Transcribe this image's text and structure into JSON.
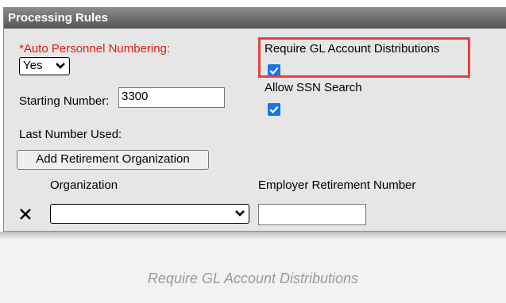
{
  "panel": {
    "title": "Processing Rules"
  },
  "auto_numbering": {
    "label": "*Auto Personnel Numbering:",
    "value": "Yes"
  },
  "starting_number": {
    "label": "Starting Number:",
    "value": "3300"
  },
  "last_number": {
    "label": "Last Number Used:"
  },
  "require_gl": {
    "label": "Require GL Account Distributions",
    "checked": true
  },
  "allow_ssn": {
    "label": "Allow SSN Search",
    "checked": true
  },
  "retirement": {
    "add_button_label": "Add Retirement Organization",
    "col_organization": "Organization",
    "col_employer_number": "Employer Retirement Number",
    "organization_value": "",
    "employer_number_value": ""
  },
  "caption": "Require GL Account Distributions",
  "colors": {
    "required_label": "#e8170e",
    "highlight": "#e8413c",
    "checkbox": "#1a73e8",
    "header_top": "#8a8a8a",
    "header_bottom": "#555555"
  }
}
